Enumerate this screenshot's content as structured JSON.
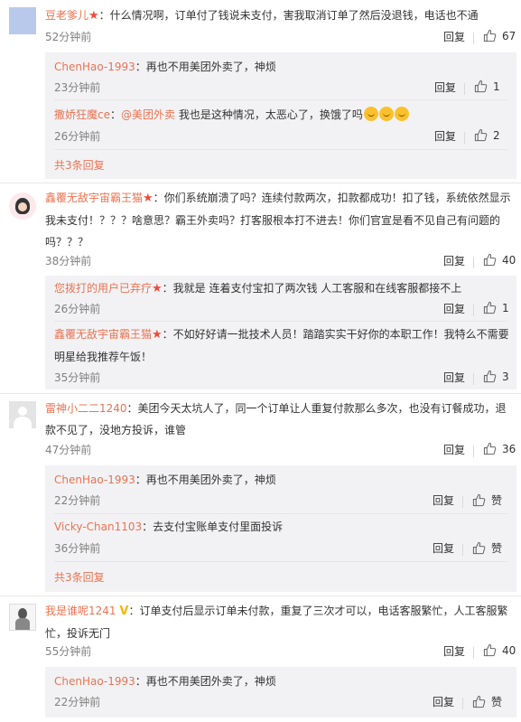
{
  "comments": [
    {
      "user": "豆老爹儿",
      "text": "：什么情况啊，订单付了钱说未支付，害我取消订单了然后没退钱，电话也不通",
      "time": "52分钟前",
      "reply": "回复",
      "likes": "67",
      "replies": [
        {
          "user": "ChenHao-1993",
          "text": "：再也不用美团外卖了，神烦",
          "time": "23分钟前",
          "reply": "回复",
          "likes": "1"
        },
        {
          "user": "撒娇狂魔ce",
          "mention": "@美团外卖",
          "text": " 我也是这种情况，太恶心了，换饿了吗",
          "time": "26分钟前",
          "reply": "回复",
          "likes": "2"
        }
      ],
      "more": "共3条回复"
    },
    {
      "user": "鑫覆无敌宇宙霸王猫",
      "text": "：你们系统崩溃了吗？连续付款两次，扣款都成功！扣了钱，系统依然显示我未支付！？？？啥意思？霸王外卖吗？打客服根本打不进去！你们官宣是看不见自己有问题的吗？？？",
      "time": "38分钟前",
      "reply": "回复",
      "likes": "40",
      "replies": [
        {
          "user": "您拨打的用户已弃疗",
          "text": "：我就是 连着支付宝扣了两次钱 人工客服和在线客服都接不上",
          "time": "26分钟前",
          "reply": "回复",
          "likes": "1"
        },
        {
          "user": "鑫覆无敌宇宙霸王猫",
          "text": "：不如好好请一批技术人员！踏踏实实干好你的本职工作！我特么不需要明星给我推荐午饭！",
          "time": "35分钟前",
          "reply": "回复",
          "likes": "3"
        }
      ]
    },
    {
      "user": "雷神小二二1240",
      "text": "：美团今天太坑人了，同一个订单让人重复付款那么多次，也没有订餐成功，退款不见了，没地方投诉，谁管",
      "time": "47分钟前",
      "reply": "回复",
      "likes": "36",
      "replies": [
        {
          "user": "ChenHao-1993",
          "text": "：再也不用美团外卖了，神烦",
          "time": "22分钟前",
          "reply": "回复",
          "likes": "赞"
        },
        {
          "user": "Vicky-Chan1103",
          "text": "：去支付宝账单支付里面投诉",
          "time": "36分钟前",
          "reply": "回复",
          "likes": "赞"
        }
      ],
      "more": "共3条回复"
    },
    {
      "user": "我是谁呢1241",
      "text": "：订单支付后显示订单未付款，重复了三次才可以，电话客服繁忙，人工客服繁忙，投诉无门",
      "time": "55分钟前",
      "reply": "回复",
      "likes": "40",
      "replies": [
        {
          "user": "ChenHao-1993",
          "text": "：再也不用美团外卖了，神烦",
          "time": "22分钟前",
          "reply": "回复",
          "likes": "赞"
        }
      ]
    }
  ],
  "colors": {
    "username": "#eb7350",
    "sub_bg": "#f2f2f5",
    "badge": "#f14a3c",
    "v_badge": "#f7b500"
  }
}
